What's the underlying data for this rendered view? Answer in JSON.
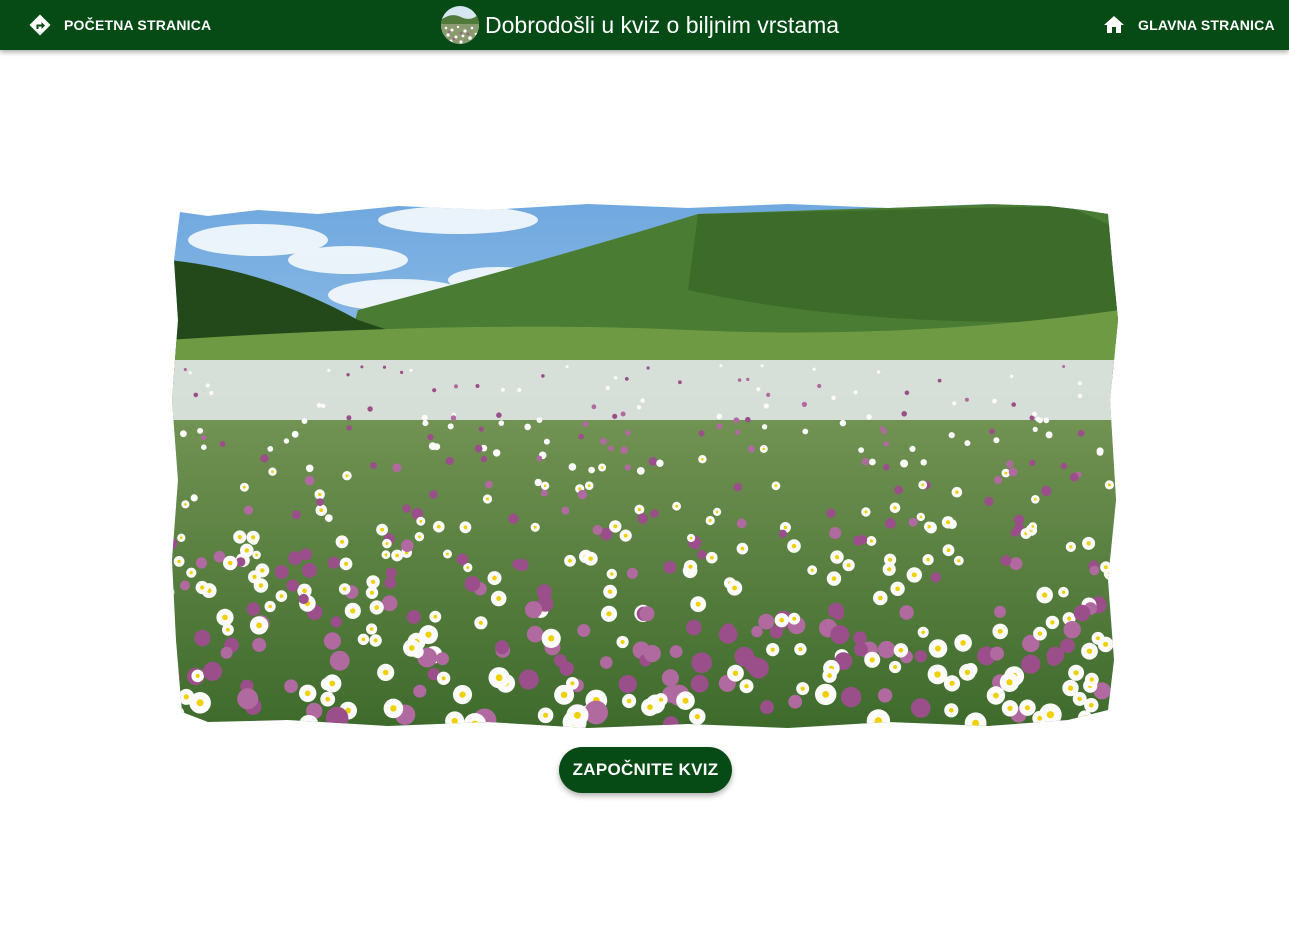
{
  "header": {
    "left_nav_label": "POČETNA STRANICA",
    "left_nav_icon": "directions-icon",
    "title": "Dobrodošli u kviz o biljnim vrstama",
    "avatar_icon": "meadow-thumbnail",
    "right_nav_label": "GLAVNA STRANICA",
    "right_nav_icon": "home-icon",
    "background_color": "#064b16",
    "text_color": "#ffffff"
  },
  "main": {
    "hero_image": "meadow-wildflowers-image",
    "start_button_label": "ZAPOČNITE KVIZ",
    "button_color": "#064b16"
  }
}
